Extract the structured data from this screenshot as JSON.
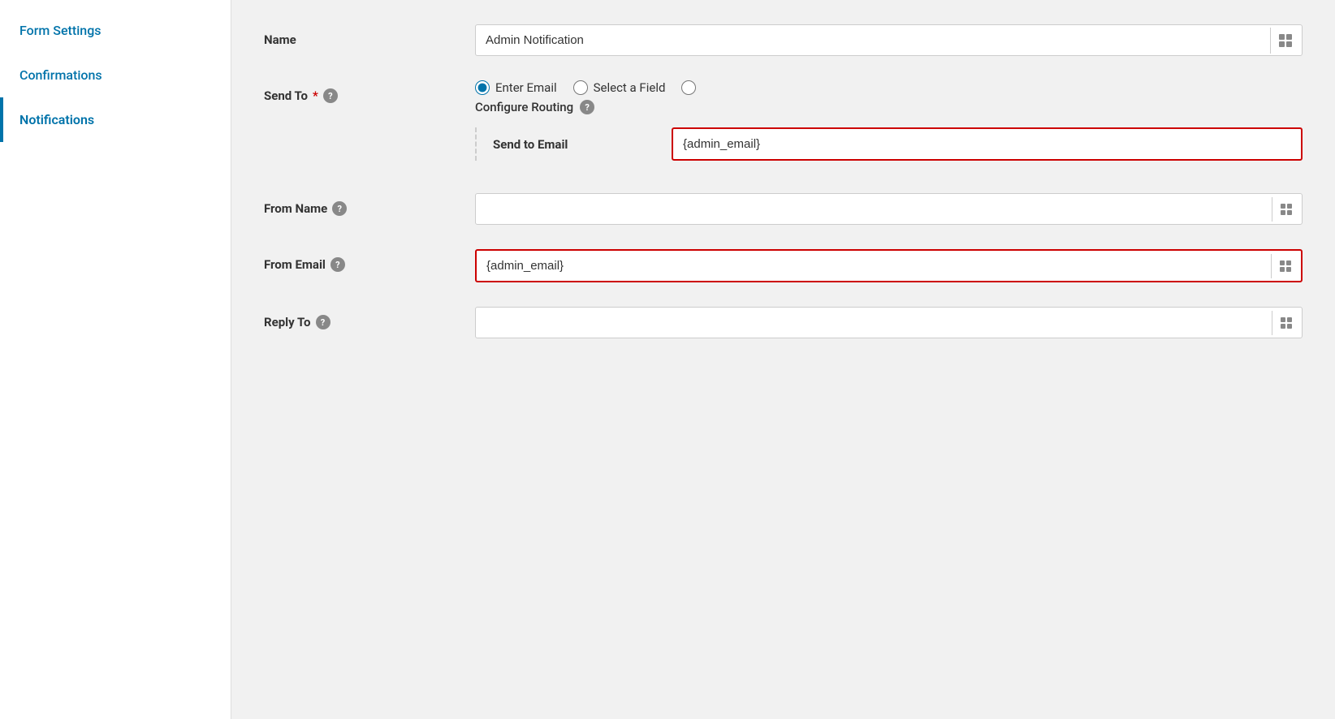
{
  "sidebar": {
    "items": [
      {
        "id": "form-settings",
        "label": "Form Settings",
        "active": false
      },
      {
        "id": "confirmations",
        "label": "Confirmations",
        "active": false
      },
      {
        "id": "notifications",
        "label": "Notifications",
        "active": true
      }
    ]
  },
  "form": {
    "name_label": "Name",
    "name_value": "Admin Notification",
    "send_to_label": "Send To",
    "send_to_required": "*",
    "send_to_options": [
      {
        "id": "enter-email",
        "label": "Enter Email",
        "checked": true
      },
      {
        "id": "select-field",
        "label": "Select a Field",
        "checked": false
      },
      {
        "id": "configure-routing-radio",
        "label": "",
        "checked": false
      }
    ],
    "configure_routing_label": "Configure Routing",
    "send_to_email_label": "Send to Email",
    "send_to_email_value": "{admin_email}",
    "from_name_label": "From Name",
    "from_name_value": "",
    "from_email_label": "From Email",
    "from_email_value": "{admin_email}",
    "reply_to_label": "Reply To",
    "reply_to_value": "",
    "help_icon_label": "?",
    "icon_doc": "🗒"
  }
}
